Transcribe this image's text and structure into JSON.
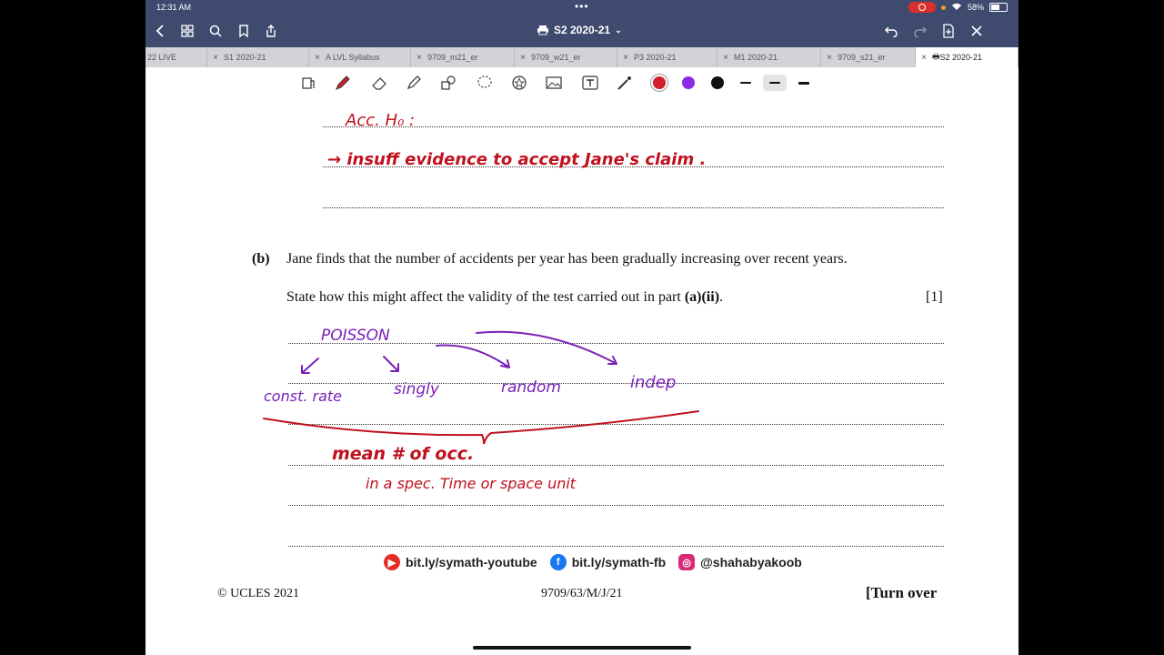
{
  "status": {
    "time": "12:31 AM",
    "battery": "58%"
  },
  "title": {
    "doc_title": "S2 2020-21"
  },
  "tabs": [
    {
      "label": "22 LIVE",
      "width": 68
    },
    {
      "label": "S1 2020-21",
      "width": 112
    },
    {
      "label": "A LVL Syllabus",
      "width": 112
    },
    {
      "label": "9709_m21_er",
      "width": 114
    },
    {
      "label": "9709_w21_er",
      "width": 113
    },
    {
      "label": "P3 2020-21",
      "width": 110
    },
    {
      "label": "M1 2020-21",
      "width": 114
    },
    {
      "label": "9709_s21_er",
      "width": 104
    },
    {
      "label": "S2 2020-21",
      "width": 113,
      "active": true
    }
  ],
  "toolbar": {
    "colors": [
      "#d0202c",
      "#8a2be2",
      "#111111"
    ]
  },
  "page": {
    "part_b_label": "(b)",
    "part_b_text": "Jane finds that the number of accidents per year has been gradually increasing over recent years.",
    "instruction_pre": "State how this might affect the validity of the test carried out in part ",
    "instruction_bold": "(a)(ii)",
    "instruction_post": ".",
    "marks": "[1]",
    "footer_left": "© UCLES 2021",
    "footer_center": "9709/63/M/J/21",
    "footer_right": "[Turn over"
  },
  "annotations": {
    "line1": "Acc. H₀ :",
    "line2": "→ insuff evidence to accept Jane's claim .",
    "poisson": "POISSON",
    "const_rate": "const. rate",
    "singly": "singly",
    "random": "random",
    "indep": "indep",
    "mean": "mean # of occ.",
    "spec": "in a spec. Time or space unit"
  },
  "social": {
    "youtube": "bit.ly/symath-youtube",
    "facebook": "bit.ly/symath-fb",
    "instagram": "@shahabyakoob"
  }
}
